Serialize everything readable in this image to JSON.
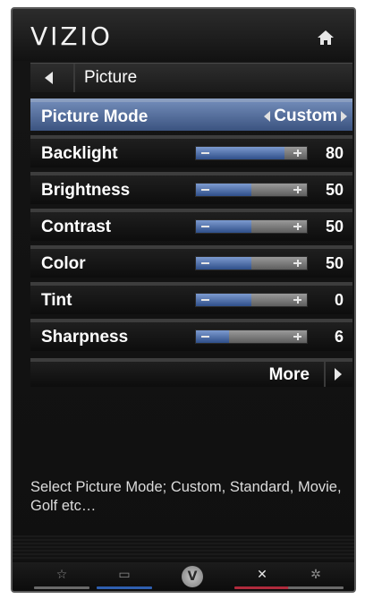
{
  "brand": {
    "logo_text": "VIZIO"
  },
  "header": {
    "home_icon": "home-icon"
  },
  "breadcrumb": {
    "title": "Picture"
  },
  "picture_mode": {
    "label": "Picture Mode",
    "value": "Custom"
  },
  "settings": [
    {
      "label": "Backlight",
      "value": "80",
      "level": 0.8
    },
    {
      "label": "Brightness",
      "value": "50",
      "level": 0.5
    },
    {
      "label": "Contrast",
      "value": "50",
      "level": 0.5
    },
    {
      "label": "Color",
      "value": "50",
      "level": 0.5
    },
    {
      "label": "Tint",
      "value": "0",
      "level": 0.5
    },
    {
      "label": "Sharpness",
      "value": "6",
      "level": 0.3
    }
  ],
  "more": {
    "label": "More"
  },
  "help": {
    "text": "Select Picture Mode; Custom, Standard, Movie, Golf etc…"
  },
  "footer": {
    "buttons": [
      {
        "name": "favorites",
        "glyph": "☆",
        "line_color": "#6a6a6a"
      },
      {
        "name": "input",
        "glyph": "▭",
        "line_color": "#2f5fb0"
      },
      {
        "name": "vizio",
        "glyph": "V",
        "line_color": ""
      },
      {
        "name": "exit",
        "glyph": "✕",
        "line_color": "#b02a3c"
      },
      {
        "name": "settings",
        "glyph": "✲",
        "line_color": "#6a6a6a"
      }
    ]
  },
  "colors": {
    "selection": "#4d6799",
    "slider_fill": "#3e5f9c"
  }
}
